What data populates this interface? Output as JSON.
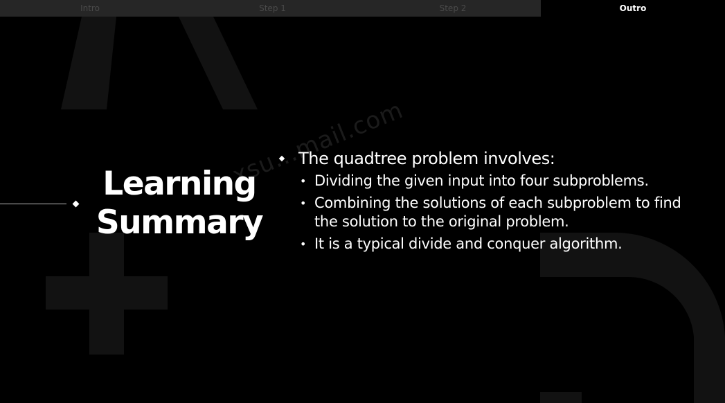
{
  "tabs": [
    {
      "label": "Intro",
      "active": false
    },
    {
      "label": "Step 1",
      "active": false
    },
    {
      "label": "Step 2",
      "active": false
    },
    {
      "label": "Outro",
      "active": true
    }
  ],
  "slide": {
    "title_line1": "Learning",
    "title_line2": "Summary",
    "main_point": "The quadtree problem involves:",
    "sub_points": [
      "Dividing the given input into four subproblems.",
      "Combining the solutions of each subproblem to find the solution to the original problem.",
      "It is a typical divide and conquer algorithm."
    ],
    "sub_bullet_glyph": "•"
  },
  "watermark": {
    "text": "xsu...mail.com"
  },
  "colors": {
    "background": "#000000",
    "tab_inactive_bg": "#262626",
    "tab_inactive_text": "#4a4a4a",
    "tab_active_text": "#ffffff",
    "text": "#ffffff",
    "decoration": "#121212"
  },
  "icons": {
    "main_bullet": "diamond-bullet-icon",
    "left_marker": "diamond-marker-icon"
  }
}
